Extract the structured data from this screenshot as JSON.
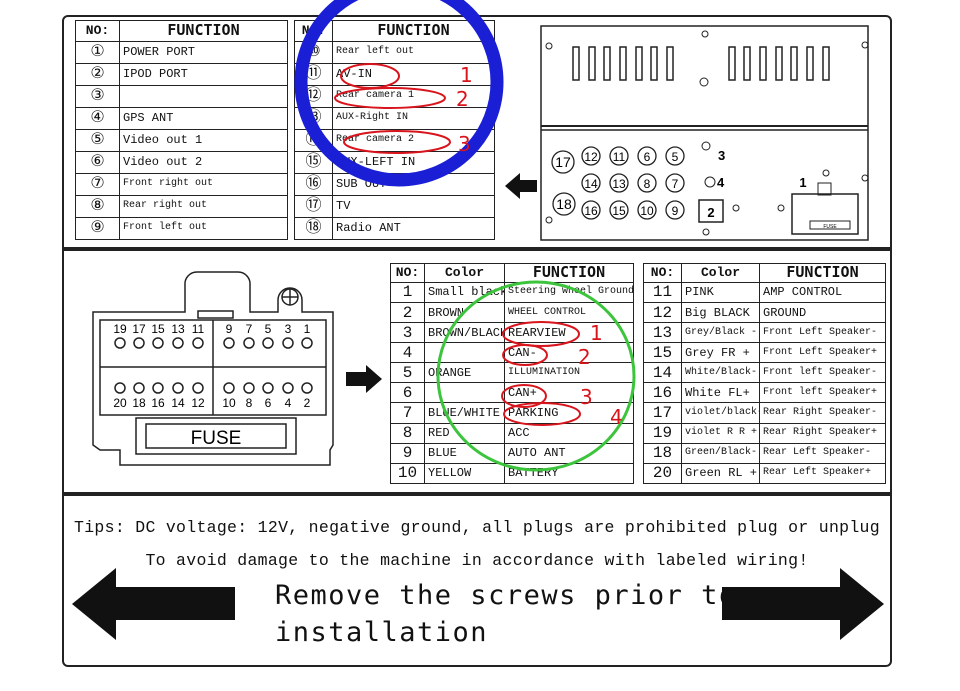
{
  "table_top_left": {
    "headers": [
      "NO:",
      "FUNCTION"
    ],
    "rows": [
      {
        "no": "①",
        "function": "POWER PORT"
      },
      {
        "no": "②",
        "function": "IPOD PORT"
      },
      {
        "no": "③",
        "function": ""
      },
      {
        "no": "④",
        "function": "GPS ANT"
      },
      {
        "no": "⑤",
        "function": "Video out 1"
      },
      {
        "no": "⑥",
        "function": "Video out 2"
      },
      {
        "no": "⑦",
        "function": "Front right out"
      },
      {
        "no": "⑧",
        "function": "Rear right out"
      },
      {
        "no": "⑨",
        "function": "Front left out"
      }
    ]
  },
  "table_top_right": {
    "headers": [
      "NO:",
      "FUNCTION"
    ],
    "rows": [
      {
        "no": "⑩",
        "function": "Rear left out"
      },
      {
        "no": "⑪",
        "function": "AV-IN"
      },
      {
        "no": "⑫",
        "function": "Rear camera 1"
      },
      {
        "no": "⑬",
        "function": "AUX-Right IN"
      },
      {
        "no": "⑭",
        "function": "Rear camera 2"
      },
      {
        "no": "⑮",
        "function": "AUX-LEFT IN"
      },
      {
        "no": "⑯",
        "function": "SUB OUT"
      },
      {
        "no": "⑰",
        "function": "TV"
      },
      {
        "no": "⑱",
        "function": "Radio ANT"
      }
    ]
  },
  "table_mid_left": {
    "headers": [
      "NO:",
      "Color",
      "FUNCTION"
    ],
    "rows": [
      {
        "no": "1",
        "color": "Small black",
        "function": "Steering wheel Ground"
      },
      {
        "no": "2",
        "color": "BROWN",
        "function": "WHEEL CONTROL"
      },
      {
        "no": "3",
        "color": "BROWN/BLACK",
        "function": "REARVIEW"
      },
      {
        "no": "4",
        "color": "",
        "function": "CAN-"
      },
      {
        "no": "5",
        "color": "ORANGE",
        "function": "ILLUMINATION"
      },
      {
        "no": "6",
        "color": "",
        "function": "CAN+"
      },
      {
        "no": "7",
        "color": "BLUE/WHITE",
        "function": "PARKING"
      },
      {
        "no": "8",
        "color": "RED",
        "function": "ACC"
      },
      {
        "no": "9",
        "color": "BLUE",
        "function": "AUTO ANT"
      },
      {
        "no": "10",
        "color": "YELLOW",
        "function": "BATTERY"
      }
    ]
  },
  "table_mid_right": {
    "headers": [
      "NO:",
      "Color",
      "FUNCTION"
    ],
    "rows": [
      {
        "no": "11",
        "color": "PINK",
        "function": "AMP CONTROL"
      },
      {
        "no": "12",
        "color": "Big BLACK",
        "function": "GROUND"
      },
      {
        "no": "13",
        "color": "Grey/Black -",
        "function": "Front Left Speaker-"
      },
      {
        "no": "15",
        "color": "Grey FR +",
        "function": "Front Left Speaker+"
      },
      {
        "no": "14",
        "color": "White/Black-",
        "function": "Front left Speaker-"
      },
      {
        "no": "16",
        "color": "White FL+",
        "function": "Front left Speaker+"
      },
      {
        "no": "17",
        "color": "violet/black-",
        "function": "Rear Right Speaker-"
      },
      {
        "no": "19",
        "color": "violet R R +",
        "function": "Rear Right Speaker+"
      },
      {
        "no": "18",
        "color": "Green/Black-",
        "function": "Rear Left Speaker-"
      },
      {
        "no": "20",
        "color": "Green RL +",
        "function": "Rear Left Speaker+"
      }
    ]
  },
  "back_panel": {
    "port_labels": [
      "17",
      "12",
      "11",
      "6",
      "5",
      "14",
      "13",
      "8",
      "7",
      "18",
      "16",
      "15",
      "10",
      "9",
      "3",
      "4",
      "2",
      "1"
    ],
    "connector_fuse": "FUSE"
  },
  "harness_connector": {
    "top_pins": [
      "19",
      "17",
      "15",
      "13",
      "11",
      "9",
      "7",
      "5",
      "3",
      "1"
    ],
    "bottom_pins": [
      "20",
      "18",
      "16",
      "14",
      "12",
      "10",
      "8",
      "6",
      "4",
      "2"
    ],
    "fuse_label": "FUSE"
  },
  "annotations": {
    "top_marks": [
      "1",
      "2",
      "3"
    ],
    "mid_marks": [
      "1",
      "2",
      "3",
      "4"
    ],
    "blue_circle_color": "#1a1fd6",
    "green_circle_color": "#3cc43c",
    "red_mark_color": "#d8141c"
  },
  "tips": {
    "line1": "Tips: DC voltage: 12V, negative ground, all plugs are prohibited plug or unplug",
    "line2": "To avoid damage to the machine in accordance with labeled wiring!",
    "big_line1": "Remove the screws prior to",
    "big_line2": "installation"
  }
}
